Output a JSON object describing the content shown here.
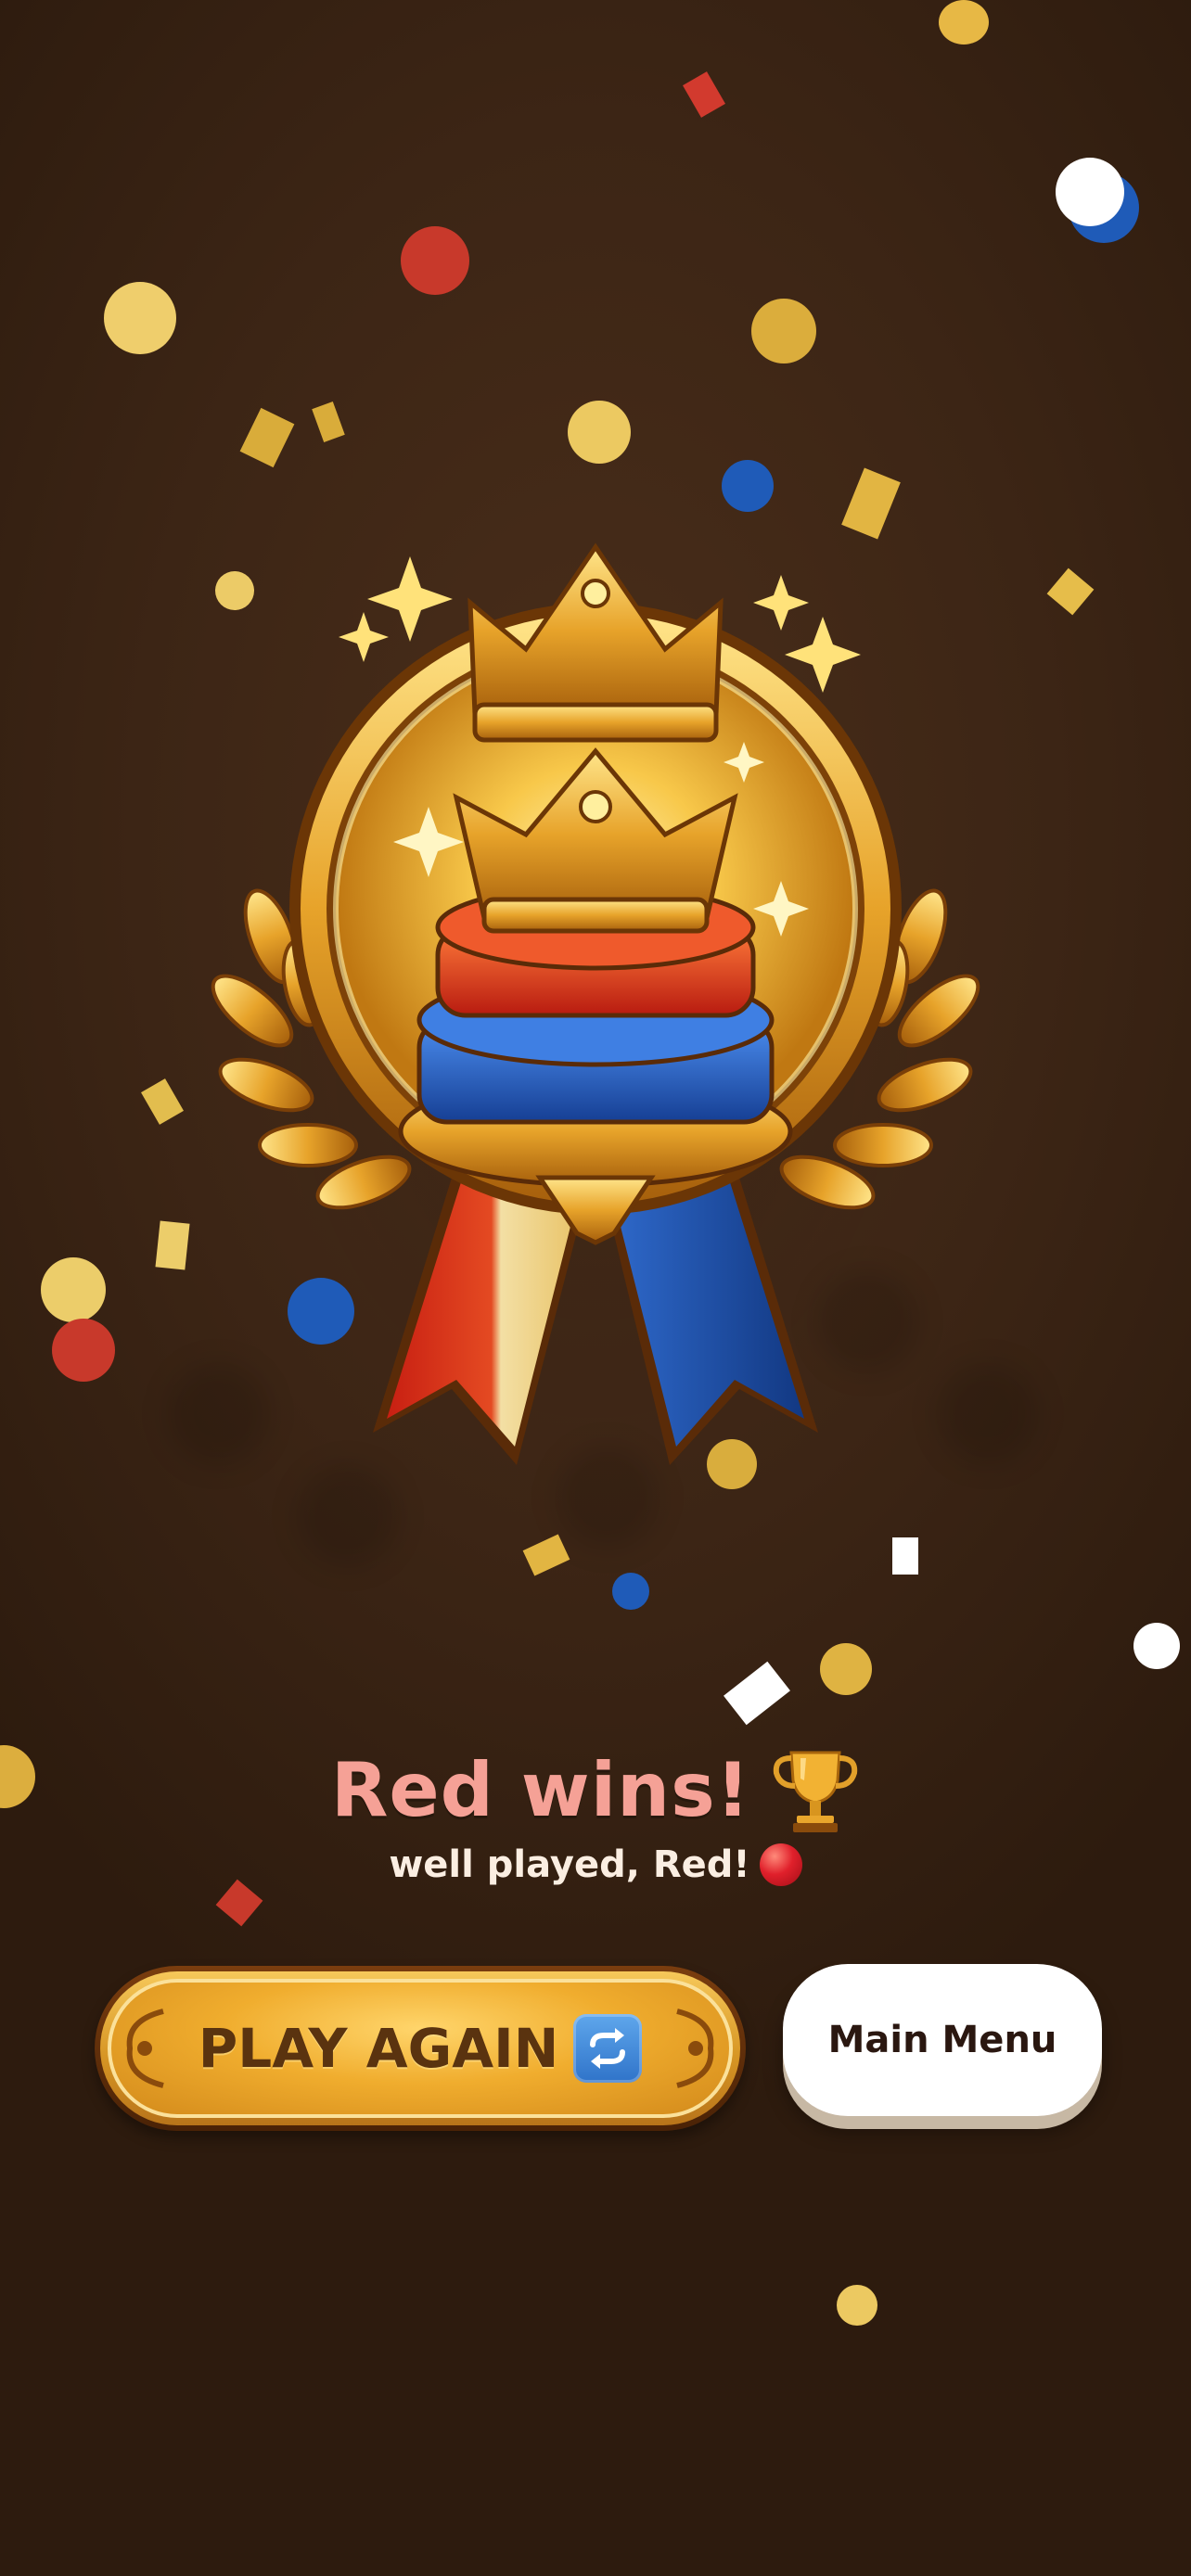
{
  "result": {
    "title": "Red wins!",
    "subtitle": "well played, Red!",
    "title_icon": "trophy-icon",
    "subtitle_icon": "red-circle-icon"
  },
  "buttons": {
    "play_again_label": "PLAY AGAIN",
    "play_again_icon": "repeat-icon",
    "main_menu_label": "Main Menu"
  },
  "badge": {
    "icon": "winner-medal-icon"
  },
  "colors": {
    "background": "#3c2515",
    "title": "#f5a196",
    "subtitle": "#fbeee2",
    "gold": "#f0ad2e",
    "red": "#d9311f",
    "blue": "#1f5bb8",
    "menu_button": "#ffffff"
  }
}
